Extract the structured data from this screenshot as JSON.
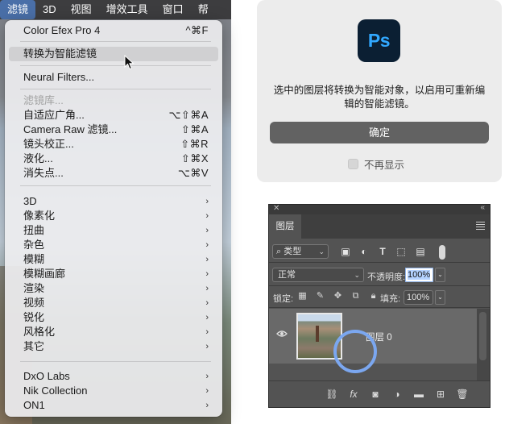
{
  "menubar": {
    "items": [
      "滤镜",
      "3D",
      "视图",
      "增效工具",
      "窗口",
      "帮"
    ]
  },
  "filter_menu": {
    "items": [
      {
        "label": "Color Efex Pro 4",
        "shortcut": "^⌘F"
      },
      {
        "label": "转换为智能滤镜",
        "shortcut": ""
      },
      {
        "label": "Neural Filters...",
        "shortcut": ""
      },
      {
        "label": "滤镜库...",
        "shortcut": ""
      },
      {
        "label": "自适应广角...",
        "shortcut": "⌥⇧⌘A"
      },
      {
        "label": "Camera Raw 滤镜...",
        "shortcut": "⇧⌘A"
      },
      {
        "label": "镜头校正...",
        "shortcut": "⇧⌘R"
      },
      {
        "label": "液化...",
        "shortcut": "⇧⌘X"
      },
      {
        "label": "消失点...",
        "shortcut": "⌥⌘V"
      }
    ],
    "submenus": [
      "3D",
      "像素化",
      "扭曲",
      "杂色",
      "模糊",
      "模糊画廊",
      "渲染",
      "视频",
      "锐化",
      "风格化",
      "其它"
    ],
    "plugins": [
      "DxO Labs",
      "Nik Collection",
      "ON1"
    ],
    "submenu_arrow": "›"
  },
  "dialog": {
    "logo_text": "Ps",
    "message": "选中的图层将转换为智能对象，以启用可重新编辑的智能滤镜。",
    "ok_label": "确定",
    "dont_show_label": "不再显示"
  },
  "layers_panel": {
    "close_glyph": "✕",
    "collapse_glyph": "«",
    "tab_label": "图层",
    "kind_label": "类型",
    "blend_mode": "正常",
    "opacity_label": "不透明度:",
    "opacity_value": "100%",
    "lock_label": "锁定:",
    "fill_label": "填充:",
    "fill_value": "100%",
    "layer_name": "图层 0",
    "footer_fx": "fx"
  },
  "colors": {
    "menubar_active": "#4a6fa8",
    "ps_logo_bg": "#0b1f33",
    "ps_logo_text": "#31a8ff",
    "highlight_ring": "#7ba7f0",
    "ok_button": "#626262"
  }
}
